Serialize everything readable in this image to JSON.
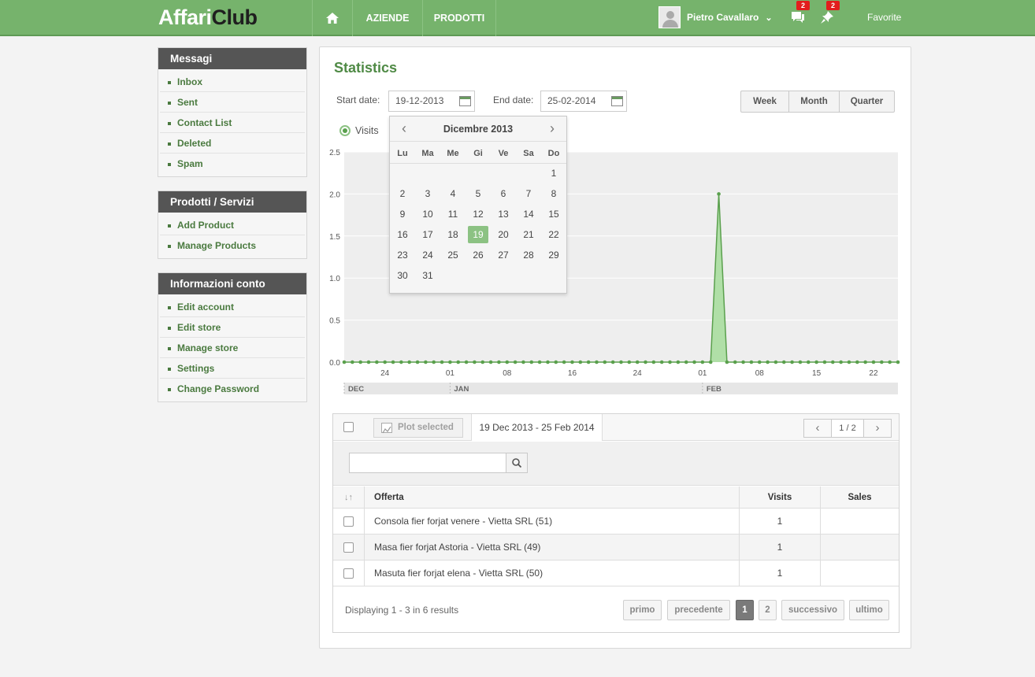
{
  "header": {
    "logo_part1": "Affari",
    "logo_part2": "Club",
    "nav": {
      "home_icon": "home-icon",
      "aziende": "AZIENDE",
      "prodotti": "PRODOTTI"
    },
    "user_name": "Pietro Cavallaro",
    "messages_badge": "2",
    "notifications_badge": "2",
    "favorite": "Favorite"
  },
  "sidebar": {
    "sections": [
      {
        "title": "Messagi",
        "items": [
          "Inbox",
          "Sent",
          "Contact List",
          "Deleted",
          "Spam"
        ]
      },
      {
        "title": "Prodotti / Servizi",
        "items": [
          "Add Product",
          "Manage Products"
        ]
      },
      {
        "title": "Informazioni conto",
        "items": [
          "Edit account",
          "Edit store",
          "Manage store",
          "Settings",
          "Change Password"
        ]
      }
    ]
  },
  "stats": {
    "title": "Statistics",
    "start_label": "Start date:",
    "start_value": "19-12-2013",
    "end_label": "End date:",
    "end_value": "25-02-2014",
    "range_buttons": [
      "Week",
      "Month",
      "Quarter"
    ],
    "legend_label": "Visits",
    "series_color": "#5aa04d"
  },
  "datepicker": {
    "month_title": "Dicembre 2013",
    "weekdays": [
      "Lu",
      "Ma",
      "Me",
      "Gi",
      "Ve",
      "Sa",
      "Do"
    ],
    "first_weekday_offset": 6,
    "days_in_month": 31,
    "selected_day": 19
  },
  "chart_data": {
    "type": "area",
    "title": "",
    "xlabel": "",
    "ylabel": "",
    "ylim": [
      0,
      2.5
    ],
    "y_ticks": [
      "0.0",
      "0.5",
      "1.0",
      "1.5",
      "2.0",
      "2.5"
    ],
    "x_tick_labels": [
      "24",
      "01",
      "08",
      "16",
      "24",
      "01",
      "08",
      "15",
      "22"
    ],
    "month_labels": [
      "DEC",
      "JAN",
      "FEB"
    ],
    "x_start": "2013-12-19",
    "x_end": "2014-02-25",
    "series": [
      {
        "name": "Visits",
        "points": [
          {
            "x": "2014-02-03",
            "y": 2
          }
        ],
        "default_y": 0
      }
    ]
  },
  "table": {
    "plot_selected": "Plot selected",
    "date_range": "19 Dec 2013 - 25 Feb 2014",
    "page_counter": "1 / 2",
    "columns": {
      "offerta": "Offerta",
      "visits": "Visits",
      "sales": "Sales"
    },
    "rows": [
      {
        "offerta": "Consola fier forjat venere - Vietta SRL (51)",
        "visits": "1",
        "sales": ""
      },
      {
        "offerta": "Masa fier forjat Astoria - Vietta SRL (49)",
        "visits": "1",
        "sales": ""
      },
      {
        "offerta": "Masuta fier forjat elena - Vietta SRL (50)",
        "visits": "1",
        "sales": ""
      }
    ],
    "display_text": "Displaying 1 - 3 in 6 results",
    "pagination": {
      "first": "primo",
      "prev": "precedente",
      "page1": "1",
      "page2": "2",
      "next": "successivo",
      "last": "ultimo"
    }
  }
}
